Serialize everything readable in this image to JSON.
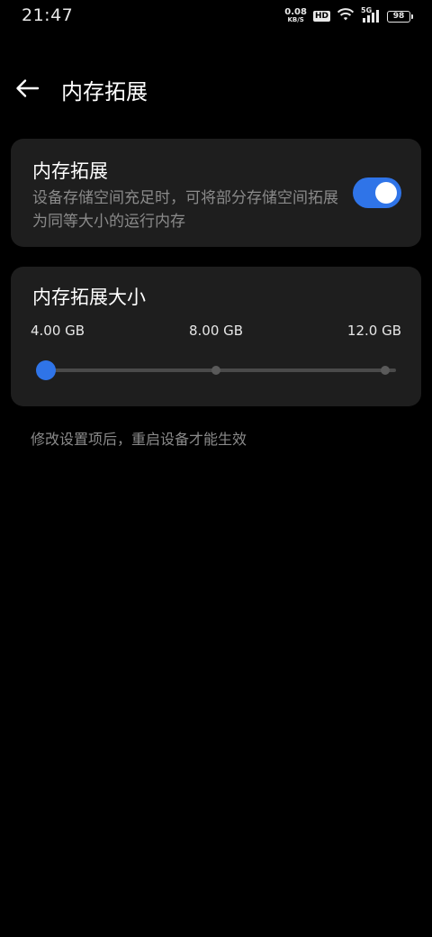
{
  "status_bar": {
    "time": "21:47",
    "net_speed_value": "0.08",
    "net_speed_unit": "KB/S",
    "hd_badge": "HD",
    "signal_label": "5G",
    "battery": "98"
  },
  "header": {
    "title": "内存拓展",
    "back_icon": "back-arrow-icon"
  },
  "memory_extension": {
    "title": "内存拓展",
    "description": "设备存储空间充足时，可将部分存储空间拓展为同等大小的运行内存",
    "enabled": true,
    "accent_color": "#2f74e8"
  },
  "extension_size": {
    "title": "内存拓展大小",
    "options": [
      "4.00 GB",
      "8.00 GB",
      "12.0 GB"
    ],
    "selected_index": 0
  },
  "footer_note": "修改设置项后，重启设备才能生效"
}
